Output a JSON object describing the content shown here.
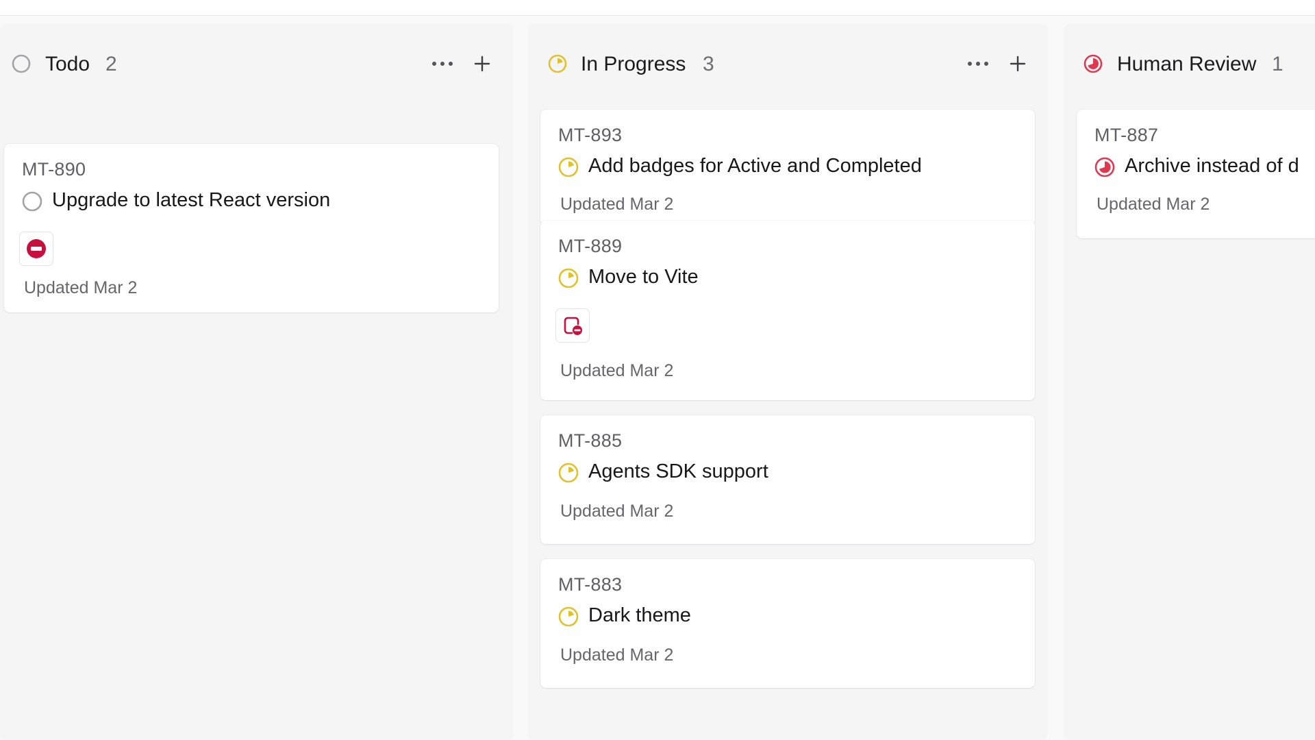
{
  "colors": {
    "todo_gray": "#a3a3a8",
    "in_progress_yellow": "#e2c12a",
    "review_red": "#e0394f",
    "blocked_red": "#c8103e"
  },
  "columns": [
    {
      "title": "Todo",
      "count": "2",
      "status_icon": "todo-circle-icon",
      "cards": [
        {
          "id": "MT-890",
          "title": "Upgrade to latest React version",
          "status_icon": "todo-circle-icon",
          "badge_icon": "blocked-icon",
          "updated": "Updated Mar 2"
        }
      ]
    },
    {
      "title": "In Progress",
      "count": "3",
      "status_icon": "in-progress-icon",
      "cards": [
        {
          "id": "MT-893",
          "title": "Add badges for Active and Completed",
          "status_icon": "in-progress-icon",
          "updated": "Updated Mar 2"
        },
        {
          "id": "MT-889",
          "title": "Move to Vite",
          "status_icon": "in-progress-icon",
          "badge_icon": "blocked-document-icon",
          "updated": "Updated Mar 2"
        },
        {
          "id": "MT-885",
          "title": "Agents SDK support",
          "status_icon": "in-progress-icon",
          "updated": "Updated Mar 2"
        },
        {
          "id": "MT-883",
          "title": "Dark theme",
          "status_icon": "in-progress-icon",
          "updated": "Updated Mar 2"
        }
      ]
    },
    {
      "title": "Human Review",
      "count": "1",
      "status_icon": "human-review-icon",
      "cards": [
        {
          "id": "MT-887",
          "title": "Archive instead of d",
          "status_icon": "human-review-icon",
          "updated": "Updated Mar 2"
        }
      ]
    }
  ]
}
